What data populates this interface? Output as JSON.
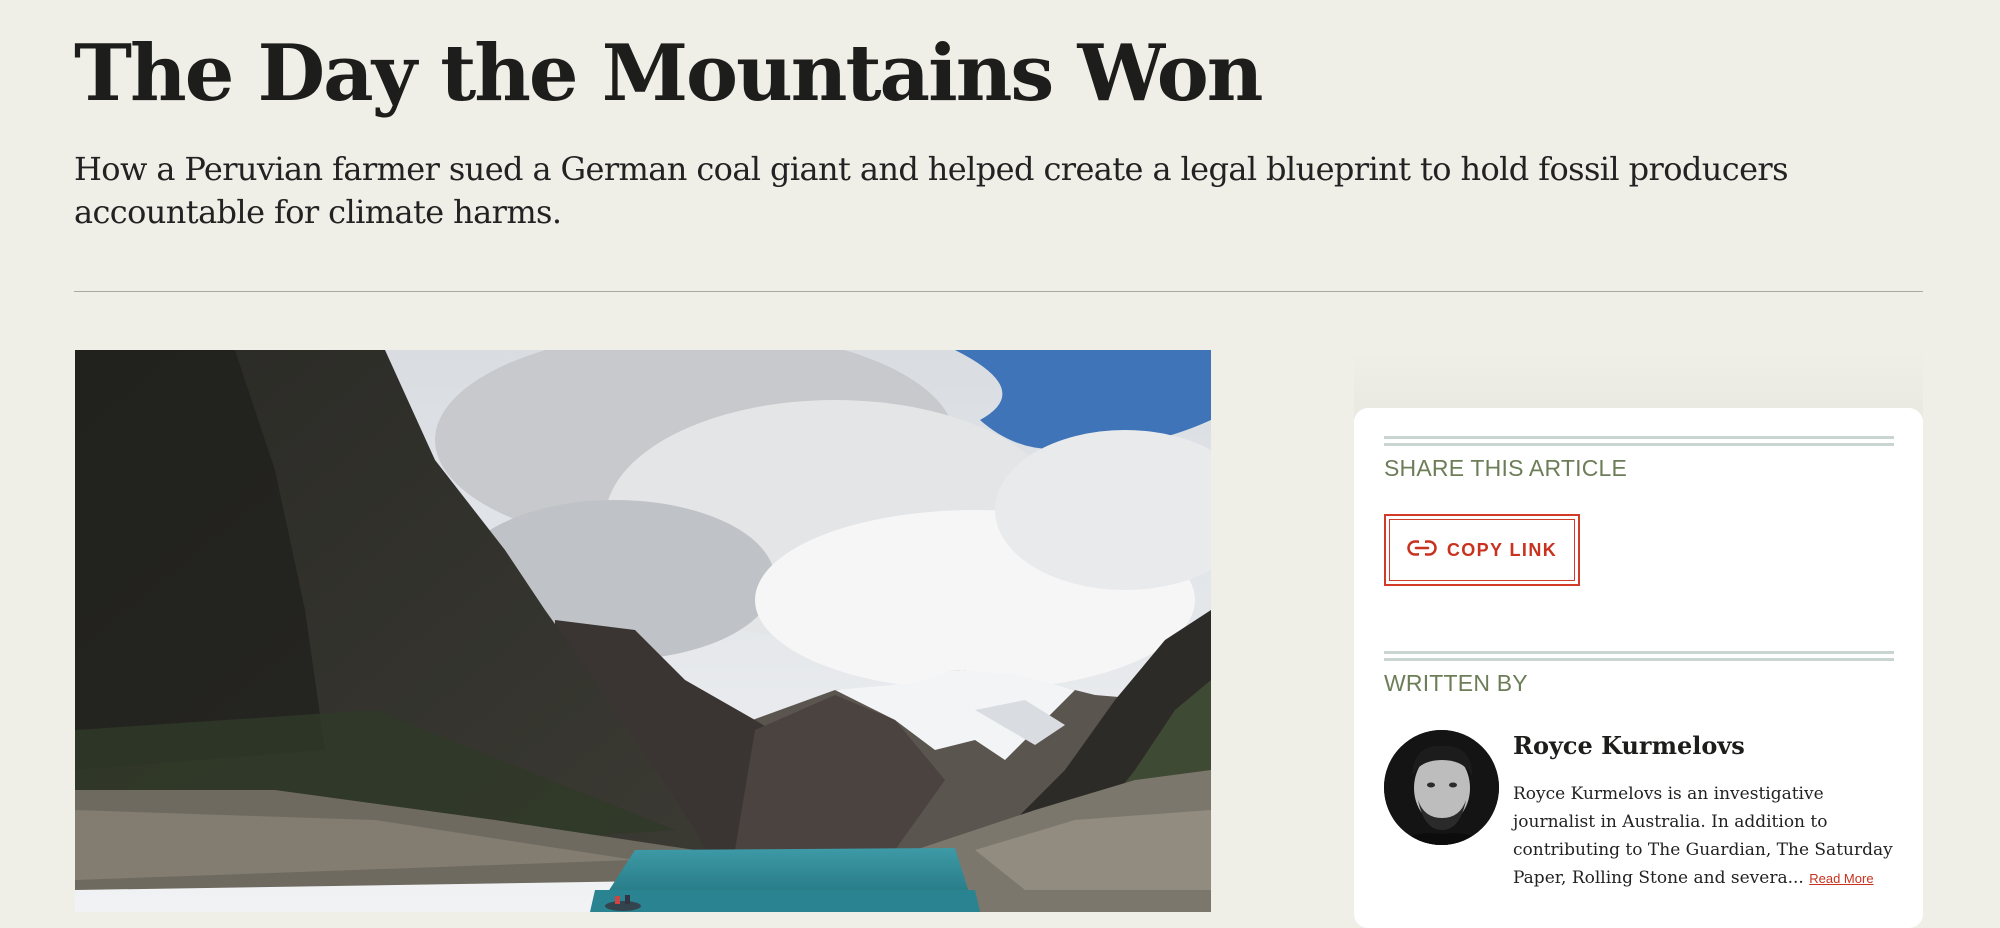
{
  "article": {
    "title": "The Day the Mountains Won",
    "subtitle": "How a Peruvian farmer sued a German coal giant and helped create a legal blueprint to hold fossil producers accountable for climate harms."
  },
  "hero_image": {
    "description_icon": "mountain-lake-photo"
  },
  "share": {
    "heading": "SHARE THIS ARTICLE",
    "copy_link_label": "COPY LINK",
    "copy_link_icon": "link-icon"
  },
  "author": {
    "heading": "WRITTEN BY",
    "name": "Royce Kurmelovs",
    "bio": "Royce Kurmelovs is an investigative journalist in Australia. In addition to contributing to The Guardian, The Saturday Paper, Rolling Stone and severa...",
    "read_more": "Read More"
  },
  "colors": {
    "background": "#efefe8",
    "accent": "#c8321f",
    "label_green": "#6d7d58",
    "rule": "#c9d5d1"
  }
}
